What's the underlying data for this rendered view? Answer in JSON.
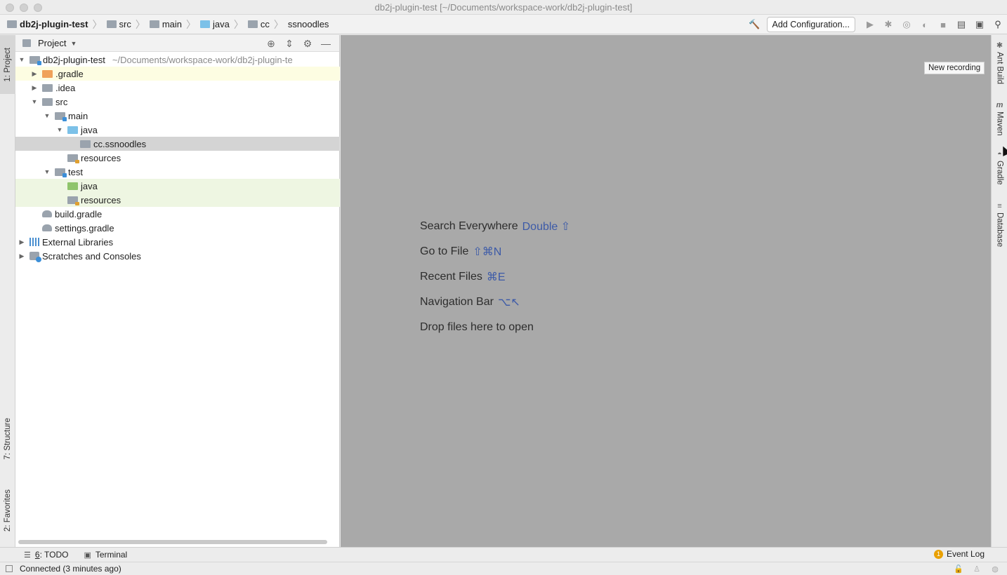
{
  "window": {
    "title": "db2j-plugin-test [~/Documents/workspace-work/db2j-plugin-test]"
  },
  "breadcrumbs": [
    "db2j-plugin-test",
    "src",
    "main",
    "java",
    "cc",
    "ssnoodles"
  ],
  "toolbar": {
    "add_configuration": "Add Configuration..."
  },
  "left_tabs": {
    "project": "1: Project",
    "structure": "7: Structure",
    "favorites": "2: Favorites"
  },
  "right_tabs": {
    "ant": "Ant Build",
    "maven": "Maven",
    "gradle": "Gradle",
    "database": "Database"
  },
  "project_panel": {
    "title": "Project",
    "root": {
      "name": "db2j-plugin-test",
      "path": "~/Documents/workspace-work/db2j-plugin-te"
    },
    "nodes": {
      "gradle": ".gradle",
      "idea": ".idea",
      "src": "src",
      "main": "main",
      "main_java": "java",
      "package": "cc.ssnoodles",
      "main_resources": "resources",
      "test": "test",
      "test_java": "java",
      "test_resources": "resources",
      "build_gradle": "build.gradle",
      "settings_gradle": "settings.gradle",
      "external_libraries": "External Libraries",
      "scratches": "Scratches and Consoles"
    }
  },
  "editor_hints": [
    {
      "label": "Search Everywhere",
      "shortcut": "Double ⇧"
    },
    {
      "label": "Go to File",
      "shortcut": "⇧⌘N"
    },
    {
      "label": "Recent Files",
      "shortcut": "⌘E"
    },
    {
      "label": "Navigation Bar",
      "shortcut": "⌥↖"
    },
    {
      "label": "Drop files here to open",
      "shortcut": ""
    }
  ],
  "tooltip": "New recording",
  "bottom_tabs": {
    "todo_num": "6",
    "todo": ": TODO",
    "terminal": "Terminal",
    "event_log": "Event Log",
    "event_count": "1"
  },
  "status": "Connected (3 minutes ago)"
}
